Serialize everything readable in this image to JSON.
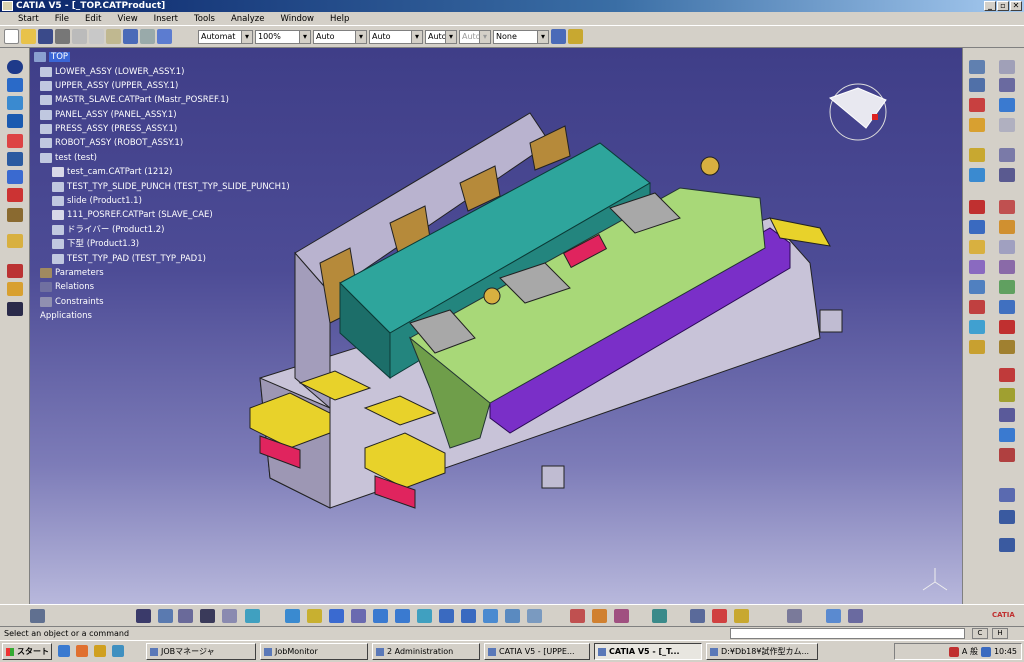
{
  "window": {
    "title": "CATIA V5 - [_TOP.CATProduct]",
    "min": "_",
    "max": "▫",
    "close": "✕"
  },
  "menu": [
    "Start",
    "File",
    "Edit",
    "View",
    "Insert",
    "Tools",
    "Analyze",
    "Window",
    "Help"
  ],
  "toolbar": {
    "combos": [
      {
        "value": "Automat",
        "enabled": true
      },
      {
        "value": "100%",
        "enabled": true
      },
      {
        "value": "Auto",
        "enabled": true
      },
      {
        "value": "Auto",
        "enabled": true
      },
      {
        "value": "Auto",
        "enabled": true
      },
      {
        "value": "Auto",
        "enabled": false
      },
      {
        "value": "None",
        "enabled": true
      }
    ]
  },
  "tree": {
    "root": "TOP",
    "nodes": [
      "LOWER_ASSY (LOWER_ASSY.1)",
      "UPPER_ASSY (UPPER_ASSY.1)",
      "MASTR_SLAVE.CATPart (Mastr_POSREF.1)",
      "PANEL_ASSY (PANEL_ASSY.1)",
      "PRESS_ASSY (PRESS_ASSY.1)",
      "ROBOT_ASSY (ROBOT_ASSY.1)",
      "test (test)",
      "test_cam.CATPart (1212)",
      "TEST_TYP_SLIDE_PUNCH (TEST_TYP_SLIDE_PUNCH1)",
      "slide (Product1.1)",
      "111_POSREF.CATPart (SLAVE_CAE)",
      "ドライバー (Product1.2)",
      "下型 (Product1.3)",
      "TEST_TYP_PAD (TEST_TYP_PAD1)",
      "Parameters",
      "Relations",
      "Constraints",
      "Applications"
    ]
  },
  "status": {
    "text": "Select an object or a command"
  },
  "taskbar": {
    "start": "スタート",
    "tasks": [
      "JOBマネージャ",
      "JobMonitor",
      "2 Administration",
      "CATIA V5 - [UPPE...",
      "CATIA V5 - [_T...",
      "D:¥Db18¥試作型カム..."
    ],
    "tray": [
      "A 般",
      "10:45"
    ]
  },
  "brand": "CATIA",
  "colors": {
    "tree_text": "#ffffff",
    "tree_selected": "#3a66d6",
    "viewport_top": "#3f3e88",
    "viewport_bottom": "#b8b8dc"
  }
}
